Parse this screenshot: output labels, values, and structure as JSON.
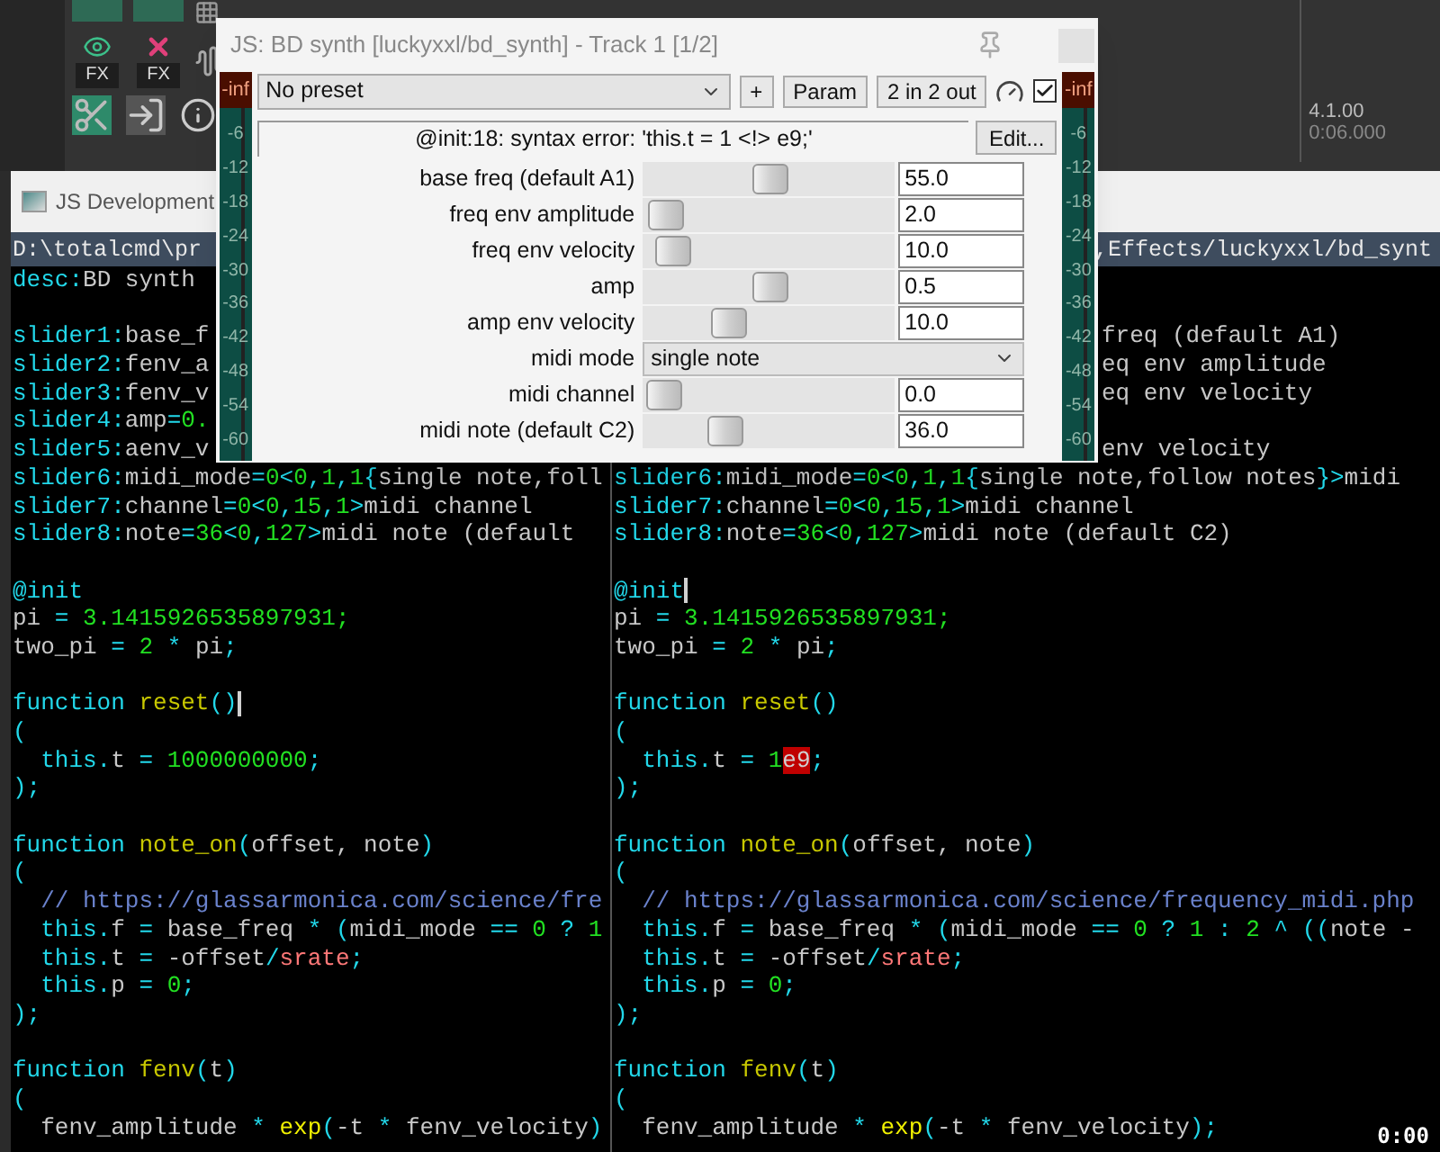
{
  "daw": {
    "fx_buttons": [
      {
        "kind": "eye",
        "label": "FX"
      },
      {
        "kind": "cross",
        "label": "FX"
      }
    ],
    "tools": [
      {
        "kind": "scissors"
      },
      {
        "kind": "import"
      },
      {
        "kind": "info"
      }
    ],
    "position": {
      "bars": "4.1.00",
      "time": "0:06.000"
    }
  },
  "editor_window": {
    "title": "JS Development",
    "panes": [
      {
        "path": "D:\\totalcmd\\pr",
        "lines": [
          {
            "kind": "code",
            "segments": [
              {
                "kind": "k",
                "text": "desc:"
              },
              {
                "kind": "t",
                "text": "BD synth"
              }
            ]
          },
          {
            "kind": "blank"
          },
          {
            "kind": "code",
            "segments": [
              {
                "kind": "k",
                "text": "slider1:"
              },
              {
                "kind": "t",
                "text": "base_f"
              }
            ]
          },
          {
            "kind": "code",
            "segments": [
              {
                "kind": "k",
                "text": "slider2:"
              },
              {
                "kind": "t",
                "text": "fenv_a"
              }
            ]
          },
          {
            "kind": "code",
            "segments": [
              {
                "kind": "k",
                "text": "slider3:"
              },
              {
                "kind": "t",
                "text": "fenv_v"
              }
            ]
          },
          {
            "kind": "code",
            "segments": [
              {
                "kind": "k",
                "text": "slider4:"
              },
              {
                "kind": "t",
                "text": "amp"
              },
              {
                "kind": "k",
                "text": "="
              },
              {
                "kind": "n",
                "text": "0."
              }
            ]
          },
          {
            "kind": "code",
            "segments": [
              {
                "kind": "k",
                "text": "slider5:"
              },
              {
                "kind": "t",
                "text": "aenv_v"
              }
            ]
          },
          {
            "kind": "code",
            "segments": [
              {
                "kind": "k",
                "text": "slider6:"
              },
              {
                "kind": "t",
                "text": "midi_mode"
              },
              {
                "kind": "k",
                "text": "="
              },
              {
                "kind": "n",
                "text": "0"
              },
              {
                "kind": "k",
                "text": "<"
              },
              {
                "kind": "n",
                "text": "0"
              },
              {
                "kind": "k",
                "text": ","
              },
              {
                "kind": "n",
                "text": "1"
              },
              {
                "kind": "k",
                "text": ","
              },
              {
                "kind": "n",
                "text": "1"
              },
              {
                "kind": "k",
                "text": "{"
              },
              {
                "kind": "t",
                "text": "single note,foll"
              }
            ]
          },
          {
            "kind": "code",
            "segments": [
              {
                "kind": "k",
                "text": "slider7:"
              },
              {
                "kind": "t",
                "text": "channel"
              },
              {
                "kind": "k",
                "text": "="
              },
              {
                "kind": "n",
                "text": "0"
              },
              {
                "kind": "k",
                "text": "<"
              },
              {
                "kind": "n",
                "text": "0"
              },
              {
                "kind": "k",
                "text": ","
              },
              {
                "kind": "n",
                "text": "15"
              },
              {
                "kind": "k",
                "text": ","
              },
              {
                "kind": "n",
                "text": "1"
              },
              {
                "kind": "k",
                "text": ">"
              },
              {
                "kind": "t",
                "text": "midi channel"
              }
            ]
          },
          {
            "kind": "code",
            "segments": [
              {
                "kind": "k",
                "text": "slider8:"
              },
              {
                "kind": "t",
                "text": "note"
              },
              {
                "kind": "k",
                "text": "="
              },
              {
                "kind": "n",
                "text": "36"
              },
              {
                "kind": "k",
                "text": "<"
              },
              {
                "kind": "n",
                "text": "0"
              },
              {
                "kind": "k",
                "text": ","
              },
              {
                "kind": "n",
                "text": "127"
              },
              {
                "kind": "k",
                "text": ">"
              },
              {
                "kind": "t",
                "text": "midi note (default"
              }
            ]
          },
          {
            "kind": "blank"
          },
          {
            "kind": "code",
            "segments": [
              {
                "kind": "k",
                "text": "@init"
              }
            ]
          },
          {
            "kind": "code",
            "segments": [
              {
                "kind": "t",
                "text": "pi "
              },
              {
                "kind": "k",
                "text": "= "
              },
              {
                "kind": "n",
                "text": "3.1415926535897931;"
              }
            ]
          },
          {
            "kind": "code",
            "segments": [
              {
                "kind": "t",
                "text": "two_pi "
              },
              {
                "kind": "k",
                "text": "= "
              },
              {
                "kind": "n",
                "text": "2 "
              },
              {
                "kind": "k",
                "text": "* "
              },
              {
                "kind": "t",
                "text": "pi"
              },
              {
                "kind": "k",
                "text": ";"
              }
            ]
          },
          {
            "kind": "blank"
          },
          {
            "kind": "code",
            "segments": [
              {
                "kind": "k",
                "text": "function "
              },
              {
                "kind": "f",
                "text": "reset"
              },
              {
                "kind": "k",
                "text": "()"
              },
              {
                "kind": "cursor"
              }
            ]
          },
          {
            "kind": "code",
            "segments": [
              {
                "kind": "k",
                "text": "("
              }
            ]
          },
          {
            "kind": "code",
            "segments": [
              {
                "kind": "k",
                "text": "  this."
              },
              {
                "kind": "t",
                "text": "t "
              },
              {
                "kind": "k",
                "text": "= "
              },
              {
                "kind": "n",
                "text": "1000000000"
              },
              {
                "kind": "k",
                "text": ";"
              }
            ]
          },
          {
            "kind": "code",
            "segments": [
              {
                "kind": "k",
                "text": ");"
              }
            ]
          },
          {
            "kind": "blank"
          },
          {
            "kind": "code",
            "segments": [
              {
                "kind": "k",
                "text": "function "
              },
              {
                "kind": "f",
                "text": "note_on"
              },
              {
                "kind": "k",
                "text": "("
              },
              {
                "kind": "t",
                "text": "offset, note"
              },
              {
                "kind": "k",
                "text": ")"
              }
            ]
          },
          {
            "kind": "code",
            "segments": [
              {
                "kind": "k",
                "text": "("
              }
            ]
          },
          {
            "kind": "code",
            "segments": [
              {
                "kind": "c",
                "text": "  // https://glassarmonica.com/science/fre"
              }
            ]
          },
          {
            "kind": "code",
            "segments": [
              {
                "kind": "k",
                "text": "  this."
              },
              {
                "kind": "t",
                "text": "f "
              },
              {
                "kind": "k",
                "text": "= "
              },
              {
                "kind": "t",
                "text": "base_freq "
              },
              {
                "kind": "k",
                "text": "* ("
              },
              {
                "kind": "t",
                "text": "midi_mode "
              },
              {
                "kind": "k",
                "text": "== "
              },
              {
                "kind": "n",
                "text": "0 "
              },
              {
                "kind": "k",
                "text": "? "
              },
              {
                "kind": "n",
                "text": "1"
              }
            ]
          },
          {
            "kind": "code",
            "segments": [
              {
                "kind": "k",
                "text": "  this."
              },
              {
                "kind": "t",
                "text": "t "
              },
              {
                "kind": "k",
                "text": "= "
              },
              {
                "kind": "t",
                "text": "-offset"
              },
              {
                "kind": "k",
                "text": "/"
              },
              {
                "kind": "v",
                "text": "srate"
              },
              {
                "kind": "k",
                "text": ";"
              }
            ]
          },
          {
            "kind": "code",
            "segments": [
              {
                "kind": "k",
                "text": "  this."
              },
              {
                "kind": "t",
                "text": "p "
              },
              {
                "kind": "k",
                "text": "= "
              },
              {
                "kind": "n",
                "text": "0"
              },
              {
                "kind": "k",
                "text": ";"
              }
            ]
          },
          {
            "kind": "code",
            "segments": [
              {
                "kind": "k",
                "text": ");"
              }
            ]
          },
          {
            "kind": "blank"
          },
          {
            "kind": "code",
            "segments": [
              {
                "kind": "k",
                "text": "function "
              },
              {
                "kind": "f",
                "text": "fenv"
              },
              {
                "kind": "k",
                "text": "("
              },
              {
                "kind": "t",
                "text": "t"
              },
              {
                "kind": "k",
                "text": ")"
              }
            ]
          },
          {
            "kind": "code",
            "segments": [
              {
                "kind": "k",
                "text": "("
              }
            ]
          },
          {
            "kind": "code",
            "segments": [
              {
                "kind": "t",
                "text": "  fenv_amplitude "
              },
              {
                "kind": "k",
                "text": "* "
              },
              {
                "kind": "b",
                "text": "exp"
              },
              {
                "kind": "k",
                "text": "("
              },
              {
                "kind": "t",
                "text": "-t "
              },
              {
                "kind": "k",
                "text": "* "
              },
              {
                "kind": "t",
                "text": "fenv_velocity"
              },
              {
                "kind": "k",
                "text": ")"
              }
            ]
          }
        ]
      },
      {
        "path": ",Effects/luckyxxl/bd_synt",
        "lines": [
          {
            "kind": "blank"
          },
          {
            "kind": "blank"
          },
          {
            "kind": "tail",
            "segments": [
              {
                "kind": "t",
                "text": "freq (default A1)"
              }
            ]
          },
          {
            "kind": "tail",
            "segments": [
              {
                "kind": "t",
                "text": "eq env amplitude"
              }
            ]
          },
          {
            "kind": "tail",
            "segments": [
              {
                "kind": "t",
                "text": "eq env velocity"
              }
            ]
          },
          {
            "kind": "blank"
          },
          {
            "kind": "tail",
            "segments": [
              {
                "kind": "t",
                "text": "env velocity"
              }
            ]
          },
          {
            "kind": "code",
            "segments": [
              {
                "kind": "k",
                "text": "slider6:"
              },
              {
                "kind": "t",
                "text": "midi_mode"
              },
              {
                "kind": "k",
                "text": "="
              },
              {
                "kind": "n",
                "text": "0"
              },
              {
                "kind": "k",
                "text": "<"
              },
              {
                "kind": "n",
                "text": "0"
              },
              {
                "kind": "k",
                "text": ","
              },
              {
                "kind": "n",
                "text": "1"
              },
              {
                "kind": "k",
                "text": ","
              },
              {
                "kind": "n",
                "text": "1"
              },
              {
                "kind": "k",
                "text": "{"
              },
              {
                "kind": "t",
                "text": "single note,follow notes"
              },
              {
                "kind": "k",
                "text": "}>"
              },
              {
                "kind": "t",
                "text": "midi"
              }
            ]
          },
          {
            "kind": "code",
            "segments": [
              {
                "kind": "k",
                "text": "slider7:"
              },
              {
                "kind": "t",
                "text": "channel"
              },
              {
                "kind": "k",
                "text": "="
              },
              {
                "kind": "n",
                "text": "0"
              },
              {
                "kind": "k",
                "text": "<"
              },
              {
                "kind": "n",
                "text": "0"
              },
              {
                "kind": "k",
                "text": ","
              },
              {
                "kind": "n",
                "text": "15"
              },
              {
                "kind": "k",
                "text": ","
              },
              {
                "kind": "n",
                "text": "1"
              },
              {
                "kind": "k",
                "text": ">"
              },
              {
                "kind": "t",
                "text": "midi channel"
              }
            ]
          },
          {
            "kind": "code",
            "segments": [
              {
                "kind": "k",
                "text": "slider8:"
              },
              {
                "kind": "t",
                "text": "note"
              },
              {
                "kind": "k",
                "text": "="
              },
              {
                "kind": "n",
                "text": "36"
              },
              {
                "kind": "k",
                "text": "<"
              },
              {
                "kind": "n",
                "text": "0"
              },
              {
                "kind": "k",
                "text": ","
              },
              {
                "kind": "n",
                "text": "127"
              },
              {
                "kind": "k",
                "text": ">"
              },
              {
                "kind": "t",
                "text": "midi note (default C2)"
              }
            ]
          },
          {
            "kind": "blank"
          },
          {
            "kind": "code",
            "segments": [
              {
                "kind": "k",
                "text": "@init"
              },
              {
                "kind": "cursor"
              }
            ]
          },
          {
            "kind": "code",
            "segments": [
              {
                "kind": "t",
                "text": "pi "
              },
              {
                "kind": "k",
                "text": "= "
              },
              {
                "kind": "n",
                "text": "3.1415926535897931;"
              }
            ]
          },
          {
            "kind": "code",
            "segments": [
              {
                "kind": "t",
                "text": "two_pi "
              },
              {
                "kind": "k",
                "text": "= "
              },
              {
                "kind": "n",
                "text": "2 "
              },
              {
                "kind": "k",
                "text": "* "
              },
              {
                "kind": "t",
                "text": "pi"
              },
              {
                "kind": "k",
                "text": ";"
              }
            ]
          },
          {
            "kind": "blank"
          },
          {
            "kind": "code",
            "segments": [
              {
                "kind": "k",
                "text": "function "
              },
              {
                "kind": "f",
                "text": "reset"
              },
              {
                "kind": "k",
                "text": "()"
              }
            ]
          },
          {
            "kind": "code",
            "segments": [
              {
                "kind": "k",
                "text": "("
              }
            ]
          },
          {
            "kind": "code",
            "segments": [
              {
                "kind": "k",
                "text": "  this."
              },
              {
                "kind": "t",
                "text": "t "
              },
              {
                "kind": "k",
                "text": "= "
              },
              {
                "kind": "n",
                "text": "1"
              },
              {
                "kind": "e",
                "text": "e9"
              },
              {
                "kind": "k",
                "text": ";"
              }
            ]
          },
          {
            "kind": "code",
            "segments": [
              {
                "kind": "k",
                "text": ");"
              }
            ]
          },
          {
            "kind": "blank"
          },
          {
            "kind": "code",
            "segments": [
              {
                "kind": "k",
                "text": "function "
              },
              {
                "kind": "f",
                "text": "note_on"
              },
              {
                "kind": "k",
                "text": "("
              },
              {
                "kind": "t",
                "text": "offset, note"
              },
              {
                "kind": "k",
                "text": ")"
              }
            ]
          },
          {
            "kind": "code",
            "segments": [
              {
                "kind": "k",
                "text": "("
              }
            ]
          },
          {
            "kind": "code",
            "segments": [
              {
                "kind": "c",
                "text": "  // https://glassarmonica.com/science/frequency_midi.php"
              }
            ]
          },
          {
            "kind": "code",
            "segments": [
              {
                "kind": "k",
                "text": "  this."
              },
              {
                "kind": "t",
                "text": "f "
              },
              {
                "kind": "k",
                "text": "= "
              },
              {
                "kind": "t",
                "text": "base_freq "
              },
              {
                "kind": "k",
                "text": "* ("
              },
              {
                "kind": "t",
                "text": "midi_mode "
              },
              {
                "kind": "k",
                "text": "== "
              },
              {
                "kind": "n",
                "text": "0 "
              },
              {
                "kind": "k",
                "text": "? "
              },
              {
                "kind": "n",
                "text": "1 "
              },
              {
                "kind": "k",
                "text": ": "
              },
              {
                "kind": "n",
                "text": "2 "
              },
              {
                "kind": "k",
                "text": "^ (("
              },
              {
                "kind": "t",
                "text": "note -"
              }
            ]
          },
          {
            "kind": "code",
            "segments": [
              {
                "kind": "k",
                "text": "  this."
              },
              {
                "kind": "t",
                "text": "t "
              },
              {
                "kind": "k",
                "text": "= "
              },
              {
                "kind": "t",
                "text": "-offset"
              },
              {
                "kind": "k",
                "text": "/"
              },
              {
                "kind": "v",
                "text": "srate"
              },
              {
                "kind": "k",
                "text": ";"
              }
            ]
          },
          {
            "kind": "code",
            "segments": [
              {
                "kind": "k",
                "text": "  this."
              },
              {
                "kind": "t",
                "text": "p "
              },
              {
                "kind": "k",
                "text": "= "
              },
              {
                "kind": "n",
                "text": "0"
              },
              {
                "kind": "k",
                "text": ";"
              }
            ]
          },
          {
            "kind": "code",
            "segments": [
              {
                "kind": "k",
                "text": ");"
              }
            ]
          },
          {
            "kind": "blank"
          },
          {
            "kind": "code",
            "segments": [
              {
                "kind": "k",
                "text": "function "
              },
              {
                "kind": "f",
                "text": "fenv"
              },
              {
                "kind": "k",
                "text": "("
              },
              {
                "kind": "t",
                "text": "t"
              },
              {
                "kind": "k",
                "text": ")"
              }
            ]
          },
          {
            "kind": "code",
            "segments": [
              {
                "kind": "k",
                "text": "("
              }
            ]
          },
          {
            "kind": "code",
            "segments": [
              {
                "kind": "t",
                "text": "  fenv_amplitude "
              },
              {
                "kind": "k",
                "text": "* "
              },
              {
                "kind": "b",
                "text": "exp"
              },
              {
                "kind": "k",
                "text": "("
              },
              {
                "kind": "t",
                "text": "-t "
              },
              {
                "kind": "k",
                "text": "* "
              },
              {
                "kind": "t",
                "text": "fenv_velocity"
              },
              {
                "kind": "k",
                "text": ");"
              }
            ]
          }
        ]
      }
    ],
    "time_readout": "0:00"
  },
  "plugin_window": {
    "title": "JS: BD synth [luckyxxl/bd_synth] - Track 1 [1/2]",
    "meters": [
      {
        "peak": "-inf",
        "ticks": [
          "-6",
          "-12",
          "-18",
          "-24",
          "-30",
          "-36",
          "-42",
          "-48",
          "-54",
          "-60"
        ]
      },
      {
        "peak": "-inf",
        "ticks": [
          "-6",
          "-12",
          "-18",
          "-24",
          "-30",
          "-36",
          "-42",
          "-48",
          "-54",
          "-60"
        ]
      }
    ],
    "preset": "No preset",
    "buttons": [
      "+",
      "Param",
      "2 in 2 out"
    ],
    "bypass_checked": true,
    "error": "@init:18: syntax error: 'this.t = 1 <!> e9;'",
    "edit_button": "Edit...",
    "params": [
      {
        "kind": "slider",
        "label": "base freq (default A1)",
        "level": 0.51,
        "value": "55.0"
      },
      {
        "kind": "slider",
        "label": "freq env amplitude",
        "level": 0.03,
        "value": "2.0"
      },
      {
        "kind": "slider",
        "label": "freq env velocity",
        "level": 0.06,
        "value": "10.0"
      },
      {
        "kind": "slider",
        "label": "amp",
        "level": 0.51,
        "value": "0.5"
      },
      {
        "kind": "slider",
        "label": "amp env velocity",
        "level": 0.32,
        "value": "10.0"
      },
      {
        "kind": "dropdown",
        "label": "midi mode",
        "value": "single note"
      },
      {
        "kind": "slider",
        "label": "midi channel",
        "level": 0.02,
        "value": "0.0"
      },
      {
        "kind": "slider",
        "label": "midi note (default C2)",
        "level": 0.3,
        "value": "36.0"
      }
    ]
  }
}
